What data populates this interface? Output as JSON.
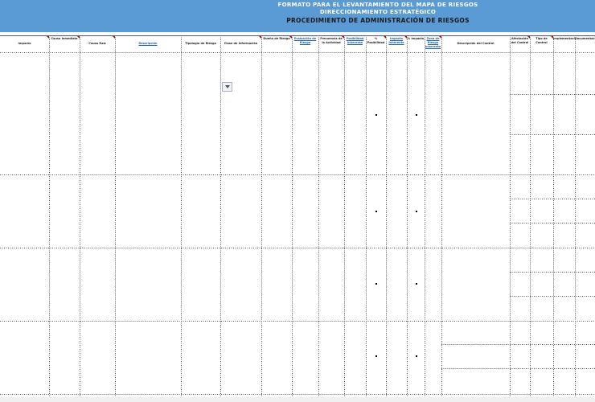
{
  "sheet": {
    "title_lines": [
      "FORMATO PARA EL LEVANTAMIENTO DEL MAPA DE RIESGOS",
      "DIRECCIONAMIENTO ESTRATÉGICO",
      "PROCEDIMIENTO DE ADMINISTRACIÓN DE RIESGOS"
    ],
    "columns": [
      "Impacto",
      "Causa Inmediata",
      "Causa Raíz",
      "Descripción",
      "Tipología de Riesgo",
      "Clase de Información",
      "Dueño de Riesgo",
      "Evaluación de Riesgo",
      "Frecuencia de la Actividad",
      "Posibilidad Inherente",
      "% Posibilidad",
      "Impacto Inherente",
      "% Impacto",
      "Zona de Riesgo Inherente",
      "Descripción del Control",
      "Afectación del Control",
      "Tipo de Control",
      "Implementación",
      "Documentación"
    ],
    "link_columns": [
      3,
      7,
      9,
      11,
      13
    ],
    "dropdown": {
      "icon": "chevron-down-icon"
    }
  }
}
